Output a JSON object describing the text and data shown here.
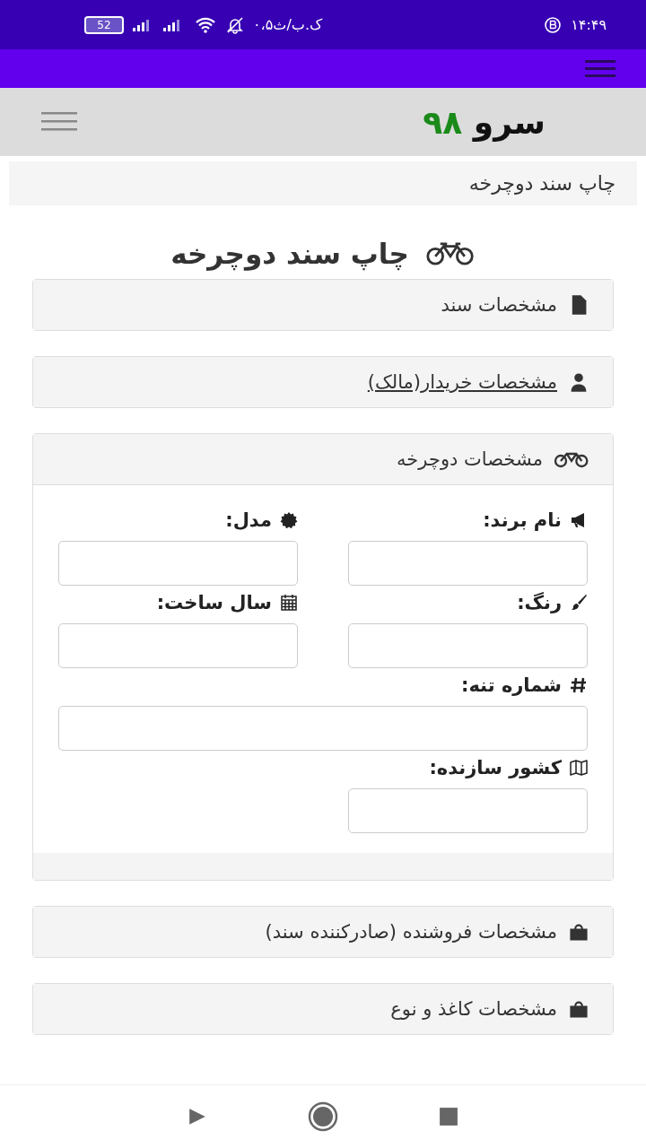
{
  "status_bar": {
    "time": "۱۴:۴۹",
    "speed": "۰،۵ک.ب/ث",
    "battery": "52"
  },
  "site_header": {
    "logo_word": "سرو",
    "logo_number": "۹۸"
  },
  "breadcrumb": "چاپ سند دوچرخه",
  "page_title": "چاپ سند دوچرخه",
  "panels": [
    {
      "title": "مشخصات سند",
      "kind": "file",
      "link": false,
      "expanded": false
    },
    {
      "title": "مشخصات خریدار(مالک)",
      "kind": "user",
      "link": true,
      "expanded": false
    },
    {
      "title": "مشخصات دوچرخه",
      "kind": "bike",
      "link": false,
      "expanded": true,
      "fields": [
        {
          "label": "نام برند:",
          "kind": "megaphone",
          "wide": false
        },
        {
          "label": "مدل:",
          "kind": "badge",
          "wide": false
        },
        {
          "label": "رنگ:",
          "kind": "brush",
          "wide": false
        },
        {
          "label": "سال ساخت:",
          "kind": "calendar",
          "wide": false
        },
        {
          "label": "شماره تنه:",
          "kind": "hash",
          "wide": true
        },
        {
          "label": "کشور سازنده:",
          "kind": "map",
          "wide": false
        }
      ]
    },
    {
      "title": "مشخصات فروشنده (صادرکننده سند)",
      "kind": "bag",
      "link": false,
      "expanded": false
    },
    {
      "title": "مشخصات کاغذ و نوع",
      "kind": "bag",
      "link": false,
      "expanded": false
    }
  ]
}
